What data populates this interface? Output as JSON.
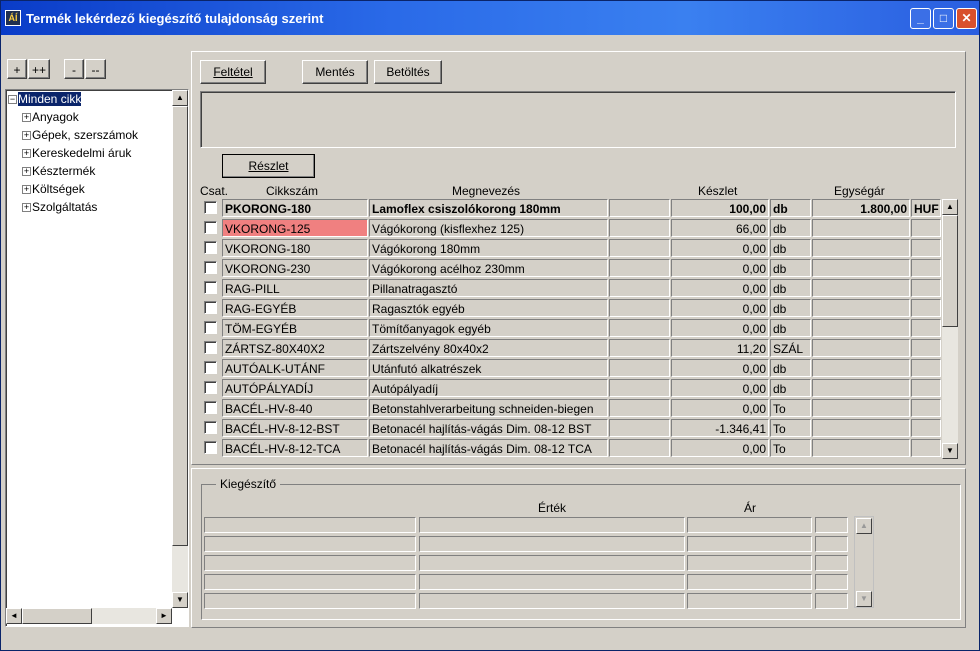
{
  "window": {
    "title": "Termék lekérdező kiegészítő tulajdonság szerint",
    "app_icon": "ÁÍ",
    "minimize": "_",
    "maximize": "□",
    "close": "✕"
  },
  "tree_buttons": [
    "+",
    "++",
    "-",
    "--"
  ],
  "tree": {
    "root": "Minden cikk",
    "children": [
      "Anyagok",
      "Gépek, szerszámok",
      "Kereskedelmi áruk",
      "Késztermék",
      "Költségek",
      "Szolgáltatás"
    ]
  },
  "toolbar": {
    "filter_label": "Feltétel",
    "save_label": "Mentés",
    "load_label": "Betöltés",
    "detail_label": "Részlet"
  },
  "table": {
    "headers": {
      "csat": "Csat.",
      "code": "Cikkszám",
      "name": "Megnevezés",
      "stock": "Készlet",
      "price": "Egységár"
    },
    "rows": [
      {
        "code": "PKORONG-180",
        "name": "Lamoflex csiszolókorong 180mm",
        "stock": "100,00",
        "unit": "db",
        "price": "1.800,00",
        "currency": "HUF"
      },
      {
        "code": "VKORONG-125",
        "name": "Vágókorong (kisflexhez 125)",
        "stock": "66,00",
        "unit": "db",
        "price": "",
        "currency": ""
      },
      {
        "code": "VKORONG-180",
        "name": "Vágókorong 180mm",
        "stock": "0,00",
        "unit": "db",
        "price": "",
        "currency": ""
      },
      {
        "code": "VKORONG-230",
        "name": "Vágókorong acélhoz 230mm",
        "stock": "0,00",
        "unit": "db",
        "price": "",
        "currency": ""
      },
      {
        "code": "RAG-PILL",
        "name": "Pillanatragasztó",
        "stock": "0,00",
        "unit": "db",
        "price": "",
        "currency": ""
      },
      {
        "code": "RAG-EGYÉB",
        "name": "Ragasztók egyéb",
        "stock": "0,00",
        "unit": "db",
        "price": "",
        "currency": ""
      },
      {
        "code": "TÖM-EGYÉB",
        "name": "Tömítőanyagok egyéb",
        "stock": "0,00",
        "unit": "db",
        "price": "",
        "currency": ""
      },
      {
        "code": "ZÁRTSZ-80X40X2",
        "name": "Zártszelvény 80x40x2",
        "stock": "11,20",
        "unit": "SZÁL",
        "price": "",
        "currency": ""
      },
      {
        "code": "AUTÓALK-UTÁNF",
        "name": "Utánfutó alkatrészek",
        "stock": "0,00",
        "unit": "db",
        "price": "",
        "currency": ""
      },
      {
        "code": "AUTÓPÁLYADÍJ",
        "name": "Autópályadíj",
        "stock": "0,00",
        "unit": "db",
        "price": "",
        "currency": ""
      },
      {
        "code": "BACÉL-HV-8-40",
        "name": "Betonstahlverarbeitung schneiden-biegen",
        "stock": "0,00",
        "unit": "To",
        "price": "",
        "currency": ""
      },
      {
        "code": "BACÉL-HV-8-12-BST",
        "name": "Betonacél hajlítás-vágás Dim. 08-12 BST",
        "stock": "-1.346,41",
        "unit": "To",
        "price": "",
        "currency": ""
      },
      {
        "code": "BACÉL-HV-8-12-TCA",
        "name": "Betonacél hajlítás-vágás Dim. 08-12 TCA",
        "stock": "0,00",
        "unit": "To",
        "price": "",
        "currency": ""
      }
    ]
  },
  "bottom": {
    "group_label": "Kiegészítő",
    "value_header": "Érték",
    "price_header": "Ár"
  },
  "colors": {
    "highlight_row_code": "#f08080",
    "title_bar": "#0a3cc8",
    "selection": "#0a246a"
  }
}
